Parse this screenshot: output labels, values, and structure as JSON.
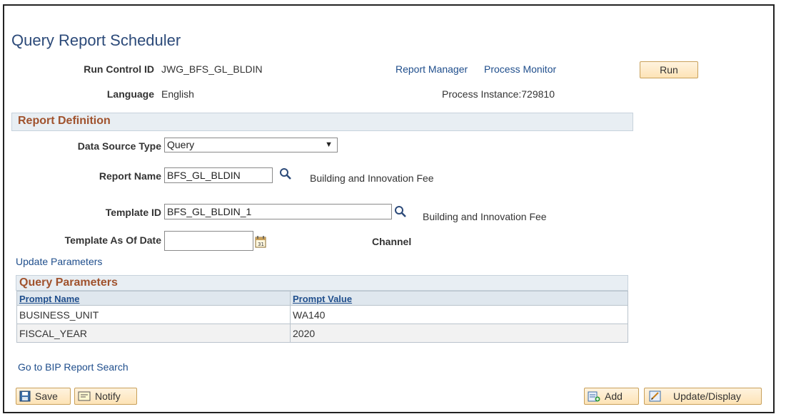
{
  "page": {
    "title": "Query Report Scheduler"
  },
  "run_control": {
    "label": "Run Control ID",
    "value": "JWG_BFS_GL_BLDIN",
    "language_label": "Language",
    "language_value": "English",
    "report_manager_link": "Report Manager",
    "process_monitor_link": "Process Monitor",
    "run_button": "Run",
    "process_instance": "Process Instance:729810"
  },
  "report_definition": {
    "header": "Report Definition",
    "data_source_label": "Data Source Type",
    "data_source_value": "Query",
    "report_name_label": "Report Name",
    "report_name_value": "BFS_GL_BLDIN",
    "report_name_desc": "Building and Innovation Fee",
    "template_id_label": "Template ID",
    "template_id_value": "BFS_GL_BLDIN_1",
    "template_id_desc": "Building and Innovation Fee",
    "template_date_label": "Template As Of Date",
    "template_date_value": "",
    "channel_label": "Channel",
    "update_parameters_link": "Update Parameters"
  },
  "query_parameters": {
    "header": "Query Parameters",
    "columns": [
      "Prompt Name",
      "Prompt Value"
    ],
    "rows": [
      {
        "name": "BUSINESS_UNIT",
        "value": "WA140"
      },
      {
        "name": "FISCAL_YEAR",
        "value": "2020"
      }
    ]
  },
  "footer": {
    "bip_search_link": "Go to BIP Report Search",
    "save_button": "Save",
    "notify_button": "Notify",
    "add_button": "Add",
    "update_display_button": "Update/Display"
  },
  "colors": {
    "link": "#1f4e8c",
    "section_title": "#a0522d",
    "button_bg": "#fde3b6"
  }
}
